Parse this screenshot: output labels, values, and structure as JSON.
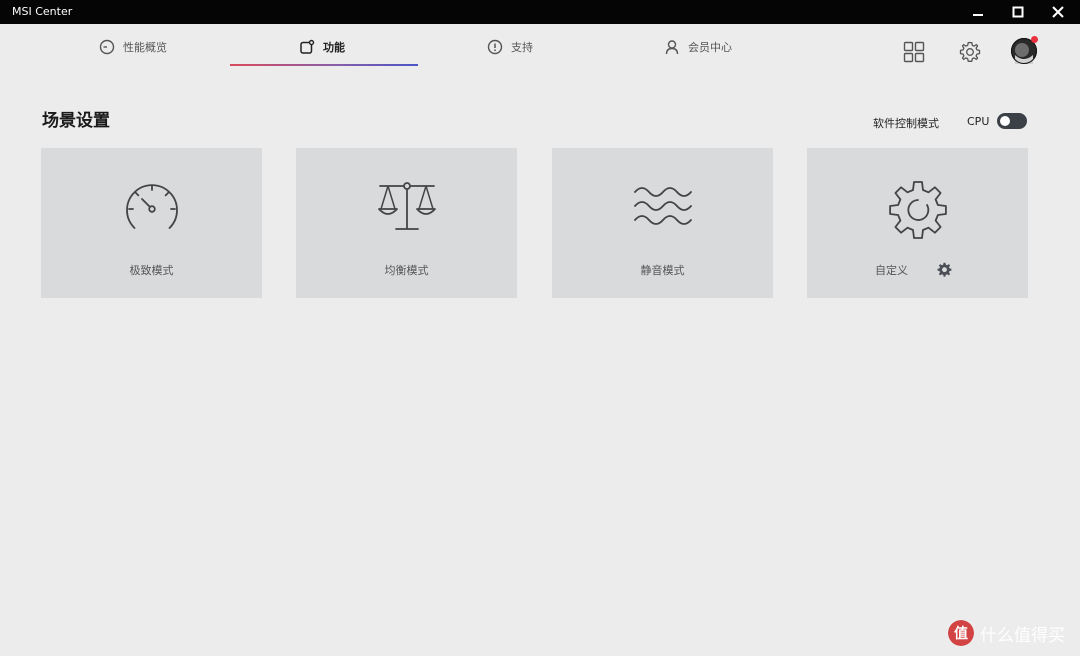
{
  "window": {
    "title": "MSI Center"
  },
  "nav": {
    "tabs": [
      {
        "label": "性能概览",
        "icon": "gauge-circle-icon",
        "active": false
      },
      {
        "label": "功能",
        "icon": "features-icon",
        "active": true
      },
      {
        "label": "支持",
        "icon": "support-icon",
        "active": false
      },
      {
        "label": "会员中心",
        "icon": "user-icon",
        "active": false
      }
    ],
    "right_icons": [
      "apps-grid-icon",
      "settings-gear-icon",
      "avatar"
    ]
  },
  "section": {
    "title": "场景设置",
    "mode_label": "软件控制模式",
    "cpu_label": "CPU",
    "cpu_toggle_on": false
  },
  "cards": [
    {
      "label": "极致模式",
      "icon": "speedometer-icon"
    },
    {
      "label": "均衡模式",
      "icon": "balance-scale-icon"
    },
    {
      "label": "静音模式",
      "icon": "waves-icon"
    },
    {
      "label": "自定义",
      "icon": "gear-icon"
    }
  ],
  "watermark": {
    "text": "什么值得买"
  },
  "colors": {
    "titlebar_bg": "#050505",
    "app_bg": "#ececec",
    "card_bg": "#d9dadc",
    "toggle_bg": "#3c4147",
    "tab_underline_start": "#d94a5c",
    "tab_underline_end": "#4a56c6",
    "avatar_dot": "#e8303e",
    "watermark_logo_bg": "#d13b3b"
  }
}
